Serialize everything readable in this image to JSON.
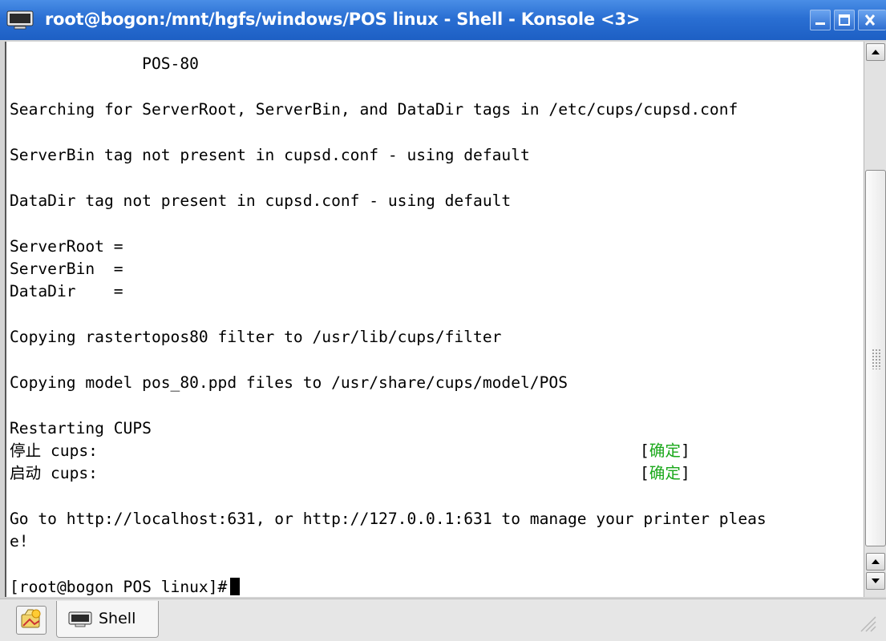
{
  "window": {
    "title": "root@bogon:/mnt/hgfs/windows/POS linux - Shell - Konsole <3>"
  },
  "terminal": {
    "lines": [
      "              POS-80",
      "",
      "Searching for ServerRoot, ServerBin, and DataDir tags in /etc/cups/cupsd.conf",
      "",
      "ServerBin tag not present in cupsd.conf - using default",
      "",
      "DataDir tag not present in cupsd.conf - using default",
      "",
      "ServerRoot =",
      "ServerBin  =",
      "DataDir    =",
      "",
      "Copying rastertopos80 filter to /usr/lib/cups/filter",
      "",
      "Copying model pos_80.ppd files to /usr/share/cups/model/POS",
      "",
      "Restarting CUPS",
      "停止 cups:",
      "启动 cups:",
      "",
      "Go to http://localhost:631, or http://127.0.0.1:631 to manage your printer pleas",
      "e!",
      "",
      "[root@bogon POS linux]#"
    ],
    "status": {
      "open": "[",
      "ok": "确定",
      "close": "]"
    }
  },
  "tabbar": {
    "tab_label": "Shell"
  },
  "colors": {
    "titlebar": "#2a6fd3",
    "ok_green": "#1aa81a"
  },
  "icons": {
    "app": "terminal-icon",
    "new_tab": "new-session-icon",
    "tab": "terminal-icon"
  }
}
